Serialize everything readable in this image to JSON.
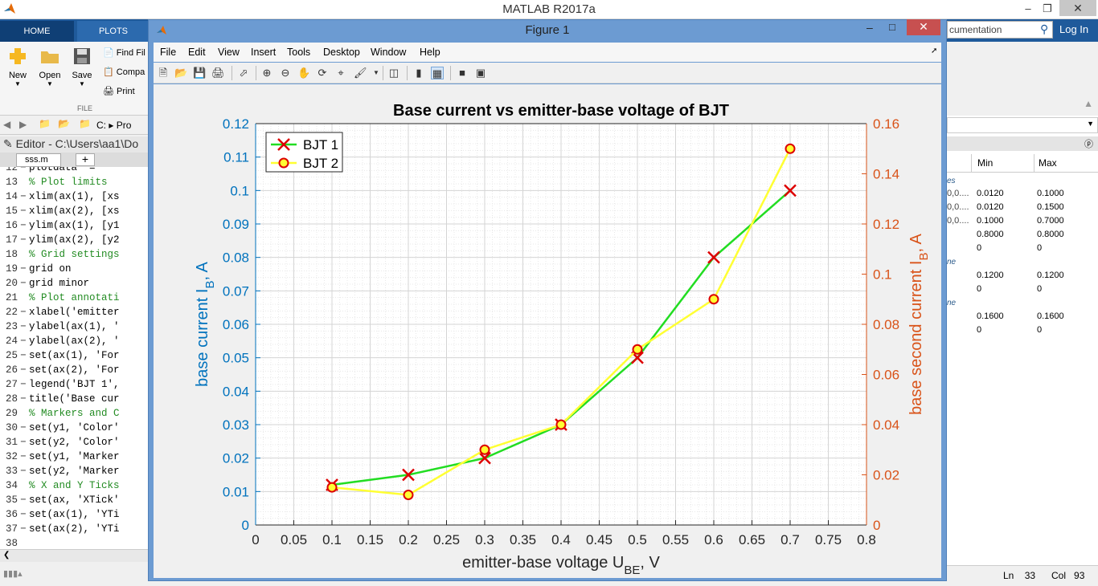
{
  "matlab": {
    "title": "MATLAB R2017a",
    "tabs": [
      "HOME",
      "PLOTS"
    ],
    "toolstrip": {
      "new": "New",
      "open": "Open",
      "save": "Save",
      "find_files": "Find Fil",
      "compare": "Compa",
      "print": "Print",
      "section_label": "FILE"
    },
    "search_placeholder": "cumentation",
    "login": "Log In",
    "address_path": "C: ▸ Pro"
  },
  "editor": {
    "title": "Editor - C:\\Users\\aa1\\Do",
    "tab": "sss.m",
    "lines": [
      {
        "n": "12",
        "dash": "−",
        "code": "plotdata  = ",
        "color": "#000000"
      },
      {
        "n": "13",
        "dash": "",
        "code": "% Plot limits",
        "color": "#228b22"
      },
      {
        "n": "14",
        "dash": "−",
        "code": "xlim(ax(1), [xs",
        "color": "#000000"
      },
      {
        "n": "15",
        "dash": "−",
        "code": "xlim(ax(2), [xs",
        "color": "#000000"
      },
      {
        "n": "16",
        "dash": "−",
        "code": "ylim(ax(1), [y1",
        "color": "#000000"
      },
      {
        "n": "17",
        "dash": "−",
        "code": "ylim(ax(2), [y2",
        "color": "#000000"
      },
      {
        "n": "18",
        "dash": "",
        "code": "% Grid settings",
        "color": "#228b22"
      },
      {
        "n": "19",
        "dash": "−",
        "code": "grid on",
        "color": "#000000"
      },
      {
        "n": "20",
        "dash": "−",
        "code": "grid minor",
        "color": "#000000"
      },
      {
        "n": "21",
        "dash": "",
        "code": "% Plot annotati",
        "color": "#228b22"
      },
      {
        "n": "22",
        "dash": "−",
        "code": "xlabel('emitter",
        "color": "#000000"
      },
      {
        "n": "23",
        "dash": "−",
        "code": "ylabel(ax(1), '",
        "color": "#000000"
      },
      {
        "n": "24",
        "dash": "−",
        "code": "ylabel(ax(2), '",
        "color": "#000000"
      },
      {
        "n": "25",
        "dash": "−",
        "code": "set(ax(1), 'For",
        "color": "#000000"
      },
      {
        "n": "26",
        "dash": "−",
        "code": "set(ax(2), 'For",
        "color": "#000000"
      },
      {
        "n": "27",
        "dash": "−",
        "code": "legend('BJT 1',",
        "color": "#000000"
      },
      {
        "n": "28",
        "dash": "−",
        "code": "title('Base cur",
        "color": "#000000"
      },
      {
        "n": "29",
        "dash": "",
        "code": "% Markers and C",
        "color": "#228b22"
      },
      {
        "n": "30",
        "dash": "−",
        "code": "set(y1, 'Color'",
        "color": "#000000"
      },
      {
        "n": "31",
        "dash": "−",
        "code": "set(y2, 'Color'",
        "color": "#000000"
      },
      {
        "n": "32",
        "dash": "−",
        "code": "set(y1, 'Marker",
        "color": "#000000"
      },
      {
        "n": "33",
        "dash": "−",
        "code": "set(y2, 'Marker",
        "color": "#000000"
      },
      {
        "n": "34",
        "dash": "",
        "code": "% X and Y Ticks",
        "color": "#228b22"
      },
      {
        "n": "35",
        "dash": "−",
        "code": "set(ax, 'XTick'",
        "color": "#000000"
      },
      {
        "n": "36",
        "dash": "−",
        "code": "set(ax(1), 'YTi",
        "color": "#000000"
      },
      {
        "n": "37",
        "dash": "−",
        "code": "set(ax(2), 'YTi",
        "color": "#000000"
      },
      {
        "n": "38",
        "dash": "",
        "code": "",
        "color": "#000000"
      }
    ]
  },
  "workspace": {
    "columns": [
      "Min",
      "Max"
    ],
    "rows": [
      {
        "trunc": "0,0....",
        "min": "0.0120",
        "max": "0.1000"
      },
      {
        "trunc": "0,0....",
        "min": "0.0120",
        "max": "0.1500"
      },
      {
        "trunc": "0,0....",
        "min": "0.1000",
        "max": "0.7000"
      },
      {
        "trunc": "",
        "min": "0.8000",
        "max": "0.8000"
      },
      {
        "trunc": "",
        "min": "0",
        "max": "0"
      },
      {
        "trunc": "",
        "min": "0.1200",
        "max": "0.1200"
      },
      {
        "trunc": "",
        "min": "0",
        "max": "0"
      },
      {
        "trunc": "",
        "min": "0.1600",
        "max": "0.1600"
      },
      {
        "trunc": "",
        "min": "0",
        "max": "0"
      }
    ],
    "group_labels": [
      "es",
      "ne",
      "ne"
    ],
    "status_ln_label": "Ln",
    "status_ln": "33",
    "status_col_label": "Col",
    "status_col": "93"
  },
  "figure": {
    "title": "Figure 1",
    "menus": [
      "File",
      "Edit",
      "View",
      "Insert",
      "Tools",
      "Desktop",
      "Window",
      "Help"
    ]
  },
  "colors": {
    "left_axis": "#0072bd",
    "right_axis": "#d95319",
    "series1": "#22dd22",
    "series1_marker": "#dd0000",
    "series2": "#ffff33",
    "series2_marker_edge": "#dd0000"
  },
  "chart_data": {
    "type": "line",
    "title": "Base current vs emitter-base voltage of BJT",
    "xlabel": "emitter-base voltage U",
    "xlabel_sub": "BE",
    "xlabel_suffix": ", V",
    "ylabel_left": "base current I",
    "ylabel_left_sub": "B",
    "ylabel_left_suffix": ", A",
    "ylabel_right": "base second current I",
    "ylabel_right_sub": "B",
    "ylabel_right_suffix": ", A",
    "xlim": [
      0,
      0.8
    ],
    "ylim_left": [
      0,
      0.12
    ],
    "ylim_right": [
      0,
      0.16
    ],
    "xticks": [
      "0",
      "0.05",
      "0.1",
      "0.15",
      "0.2",
      "0.25",
      "0.3",
      "0.35",
      "0.4",
      "0.45",
      "0.5",
      "0.55",
      "0.6",
      "0.65",
      "0.7",
      "0.75",
      "0.8"
    ],
    "yticks_left": [
      "0",
      "0.01",
      "0.02",
      "0.03",
      "0.04",
      "0.05",
      "0.06",
      "0.07",
      "0.08",
      "0.09",
      "0.1",
      "0.11",
      "0.12"
    ],
    "yticks_right": [
      "0",
      "0.02",
      "0.04",
      "0.06",
      "0.08",
      "0.1",
      "0.12",
      "0.14",
      "0.16"
    ],
    "grid": true,
    "grid_minor": true,
    "legend_position": "top-left",
    "series": [
      {
        "name": "BJT 1",
        "axis": "left",
        "marker": "x",
        "x": [
          0.1,
          0.2,
          0.3,
          0.4,
          0.5,
          0.6,
          0.7
        ],
        "y": [
          0.012,
          0.015,
          0.02,
          0.03,
          0.05,
          0.08,
          0.1
        ]
      },
      {
        "name": "BJT 2",
        "axis": "right",
        "marker": "o",
        "x": [
          0.1,
          0.2,
          0.3,
          0.4,
          0.5,
          0.6,
          0.7
        ],
        "y": [
          0.015,
          0.012,
          0.03,
          0.04,
          0.07,
          0.09,
          0.15
        ]
      }
    ]
  }
}
